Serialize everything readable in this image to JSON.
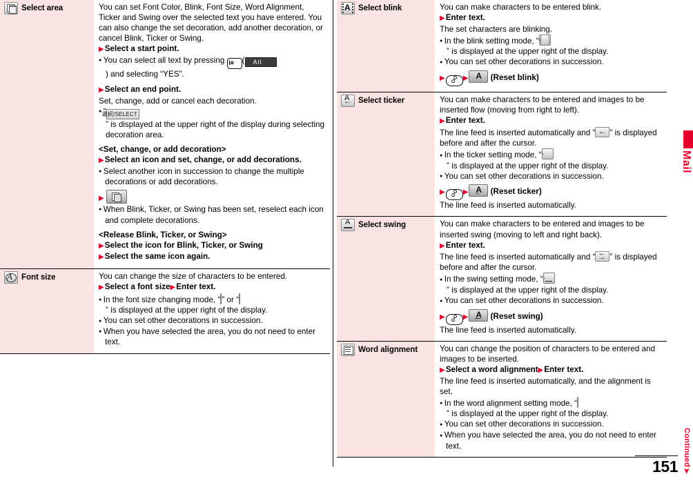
{
  "page": {
    "number": "151",
    "continued_label": "Continued",
    "side_tab_label": "Mail",
    "accent_color": "#e4002b",
    "label_cell_color": "#fae4e2"
  },
  "left_column": {
    "rows": [
      {
        "icon": "select-area-icon",
        "label": "Select area",
        "blocks": [
          {
            "kind": "para",
            "text": "You can set Font Color, Blink, Font Size, Word Alignment, Ticker and Swing over the selected text you have entered. You can also change the set decoration, add another decoration, or cancel Blink, Ticker or Swing."
          },
          {
            "kind": "step",
            "text": "Select a start point."
          },
          {
            "kind": "bullet",
            "text": "You can select all text by pressing ",
            "key": "i¤",
            "softkey": "All",
            "text2": ") and selecting “YES”."
          },
          {
            "kind": "step",
            "text": "Select an end point."
          },
          {
            "kind": "para",
            "text": "Set, change, add or cancel each decoration."
          },
          {
            "kind": "bullet",
            "text": "“",
            "selectbox": "選択/SELECT",
            "text2": "” is displayed at the upper right of the display during selecting decoration area."
          },
          {
            "kind": "section",
            "text": "<Set, change, or add decoration>"
          },
          {
            "kind": "step",
            "text": "Select an icon and set, change, or add decorations."
          },
          {
            "kind": "bullet",
            "text": "Select another icon in succession to change the multiple decorations or add decorations."
          },
          {
            "kind": "step-icon",
            "icon": "complete-decoration-icon"
          },
          {
            "kind": "bullet",
            "text": "When Blink, Ticker, or Swing has been set, reselect each icon and complete decorations."
          },
          {
            "kind": "section",
            "text": "<Release Blink, Ticker, or Swing>"
          },
          {
            "kind": "step",
            "text": "Select the icon for Blink, Ticker, or Swing"
          },
          {
            "kind": "step",
            "text": "Select the same icon again."
          }
        ]
      },
      {
        "icon": "font-size-icon",
        "label": "Font size",
        "blocks": [
          {
            "kind": "para",
            "text": "You can change the size of characters to be entered."
          },
          {
            "kind": "step2",
            "text": "Select a font size",
            "text2": "Enter text."
          },
          {
            "kind": "bullet",
            "text": "In the font size changing mode, “",
            "chip1": "font-size-small-icon",
            "mid": "” or “",
            "chip2": "font-size-large-icon",
            "text2": "” is displayed at the upper right of the display."
          },
          {
            "kind": "bullet",
            "text": "You can set other decorations in succession."
          },
          {
            "kind": "bullet",
            "text": "When you have selected the area, you do not need to enter text."
          }
        ]
      }
    ]
  },
  "right_column": {
    "rows": [
      {
        "icon": "select-blink-icon",
        "label": "Select blink",
        "blocks": [
          {
            "kind": "para",
            "text": "You can make characters to be entered blink."
          },
          {
            "kind": "step",
            "text": "Enter text."
          },
          {
            "kind": "para",
            "text": "The set characters are blinking."
          },
          {
            "kind": "bullet",
            "text": "In the blink setting mode, “",
            "chip1": "blink-mode-icon",
            "text2": "” is displayed at the upper right of the display."
          },
          {
            "kind": "bullet",
            "text": "You can set other decorations in succession."
          },
          {
            "kind": "reset",
            "key": "send-key",
            "chip": "reset-blink-icon",
            "text": "(Reset blink)"
          }
        ]
      },
      {
        "icon": "select-ticker-icon",
        "label": "Select ticker",
        "blocks": [
          {
            "kind": "para",
            "text": "You can make characters to be entered and images to be inserted flow (moving from right to left)."
          },
          {
            "kind": "step",
            "text": "Enter text."
          },
          {
            "kind": "para-chip",
            "text": "The line feed is inserted automatically and “",
            "chip": "ticker-marker-icon",
            "text2": "” is displayed before and after the cursor."
          },
          {
            "kind": "bullet",
            "text": "In the ticker setting mode, “",
            "chip1": "ticker-mode-icon",
            "text2": "” is displayed at the upper right of the display."
          },
          {
            "kind": "bullet",
            "text": "You can set other decorations in succession."
          },
          {
            "kind": "reset",
            "key": "send-key",
            "chip": "reset-ticker-icon",
            "text": "(Reset ticker)"
          },
          {
            "kind": "para",
            "text": "The line feed is inserted automatically."
          }
        ]
      },
      {
        "icon": "select-swing-icon",
        "label": "Select swing",
        "blocks": [
          {
            "kind": "para",
            "text": "You can make characters to be entered and images to be inserted swing (moving to left and right back)."
          },
          {
            "kind": "step",
            "text": "Enter text."
          },
          {
            "kind": "para-chip",
            "text": "The line feed is inserted automatically and “",
            "chip": "swing-marker-icon",
            "text2": "” is displayed before and after the cursor."
          },
          {
            "kind": "bullet",
            "text": "In the swing setting mode, “",
            "chip1": "swing-mode-icon",
            "text2": "” is displayed at the upper right of the display."
          },
          {
            "kind": "bullet",
            "text": "You can set other decorations in succession."
          },
          {
            "kind": "reset",
            "key": "send-key",
            "chip": "reset-swing-icon",
            "text": "(Reset swing)"
          },
          {
            "kind": "para",
            "text": "The line feed is inserted automatically."
          }
        ]
      },
      {
        "icon": "word-alignment-icon",
        "label": "Word alignment",
        "blocks": [
          {
            "kind": "para",
            "text": "You can change the position of characters to be entered and images to be inserted."
          },
          {
            "kind": "step2",
            "text": "Select a word alignment",
            "text2": "Enter text."
          },
          {
            "kind": "para",
            "text": "The line feed is inserted automatically, and the alignment is set."
          },
          {
            "kind": "bullet",
            "text": "In the word alignment setting mode, “",
            "chip1": "word-alignment-mode-icon",
            "text2": "” is displayed at the upper right of the display."
          },
          {
            "kind": "bullet",
            "text": "You can set other decorations in succession."
          },
          {
            "kind": "bullet",
            "text": "When you have selected the area, you do not need to enter text."
          }
        ]
      }
    ]
  }
}
